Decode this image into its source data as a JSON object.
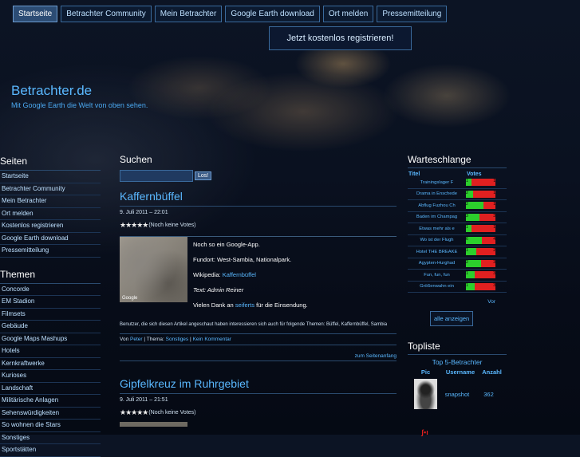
{
  "nav": {
    "tabs": [
      "Startseite",
      "Betrachter Community",
      "Mein Betrachter",
      "Google Earth download",
      "Ort melden",
      "Pressemitteilung"
    ],
    "register": "Jetzt kostenlos registrieren!"
  },
  "site": {
    "title": "Betrachter.de",
    "subtitle": "Mit Google Earth die Welt von oben sehen."
  },
  "sidebar": {
    "seiten_title": "Seiten",
    "seiten": [
      "Startseite",
      "Betrachter Community",
      "Mein Betrachter",
      "Ort melden",
      "Kostenlos registrieren",
      "Google Earth download",
      "Pressemitteilung"
    ],
    "themen_title": "Themen",
    "themen": [
      "Concorde",
      "EM Stadion",
      "Filmsets",
      "Gebäude",
      "Google Maps Mashups",
      "Hotels",
      "Kernkraftwerke",
      "Kurioses",
      "Landschaft",
      "Militärische Anlagen",
      "Sehenswürdigkeiten",
      "So wohnen die Stars",
      "Sonstiges",
      "Sportstätten"
    ]
  },
  "search": {
    "title": "Suchen",
    "button": "Los!"
  },
  "posts": [
    {
      "title": "Kaffernbüffel",
      "date": "9. Juli 2011 – 22:01",
      "votes": "(Noch keine Votes)",
      "thumb_label": "Google",
      "line1": "Noch so ein Google-App.",
      "line2": "Fundort: West-Sambia, Nationalpark.",
      "wiki_label": "Wikipedia:",
      "wiki_link": "Kaffernbüffel",
      "text_author": "Text: Admin Reiner",
      "thanks_pre": "Vielen Dank an",
      "thanks_link": "seiferts",
      "thanks_post": "für die Einsendung.",
      "tags": "Benutzer, die sich diesen Artikel angeschaut haben interessieren sich auch für folgende Themen: Büffel, Kaffernbüffel, Sambia",
      "meta_by": "Von",
      "author": "Peter",
      "meta_sep1": "| Thema:",
      "topic": "Sonstiges",
      "meta_sep2": "|",
      "comments": "Kein Kommentar",
      "to_top": "zum Seitenanfang"
    },
    {
      "title": "Gipfelkreuz im Ruhrgebiet",
      "date": "9. Juli 2011 – 21:51",
      "votes": "(Noch keine Votes)"
    }
  ],
  "queue": {
    "title": "Warteschlange",
    "col_title": "Titel",
    "col_votes": "Votes",
    "rows": [
      {
        "name": "Trainingslager F",
        "yes": "1",
        "no": "1",
        "frac": 0.2
      },
      {
        "name": "Drama in Enschede",
        "yes": "2",
        "no": "1",
        "frac": 0.25
      },
      {
        "name": "Abflug Fuzhou Ch",
        "yes": "2",
        "no": "1",
        "frac": 0.6
      },
      {
        "name": "Baden im Champag",
        "yes": "3",
        "no": "3",
        "frac": 0.45
      },
      {
        "name": "Etwas mehr als e",
        "yes": "1",
        "no": "1",
        "frac": 0.2
      },
      {
        "name": "Wo ist der Flugh",
        "yes": "6",
        "no": "4",
        "frac": 0.55
      },
      {
        "name": "Hotel THE BREAKE",
        "yes": "1",
        "no": "2",
        "frac": 0.35
      },
      {
        "name": "Ägypten-Hurghad",
        "yes": "2",
        "no": "3",
        "frac": 0.5
      },
      {
        "name": "Fun, fun, fun",
        "yes": "1",
        "no": "3",
        "frac": 0.3
      },
      {
        "name": "Größenwahn ein",
        "yes": "1",
        "no": "3",
        "frac": 0.3
      }
    ],
    "more": "Vor",
    "all": "alle anzeigen"
  },
  "toplist": {
    "title": "Topliste",
    "sub": "Top 5-Betrachter",
    "col_pic": "Pic",
    "col_user": "Username",
    "col_count": "Anzahl",
    "rows": [
      {
        "user": "snapshot",
        "count": "362"
      }
    ]
  }
}
